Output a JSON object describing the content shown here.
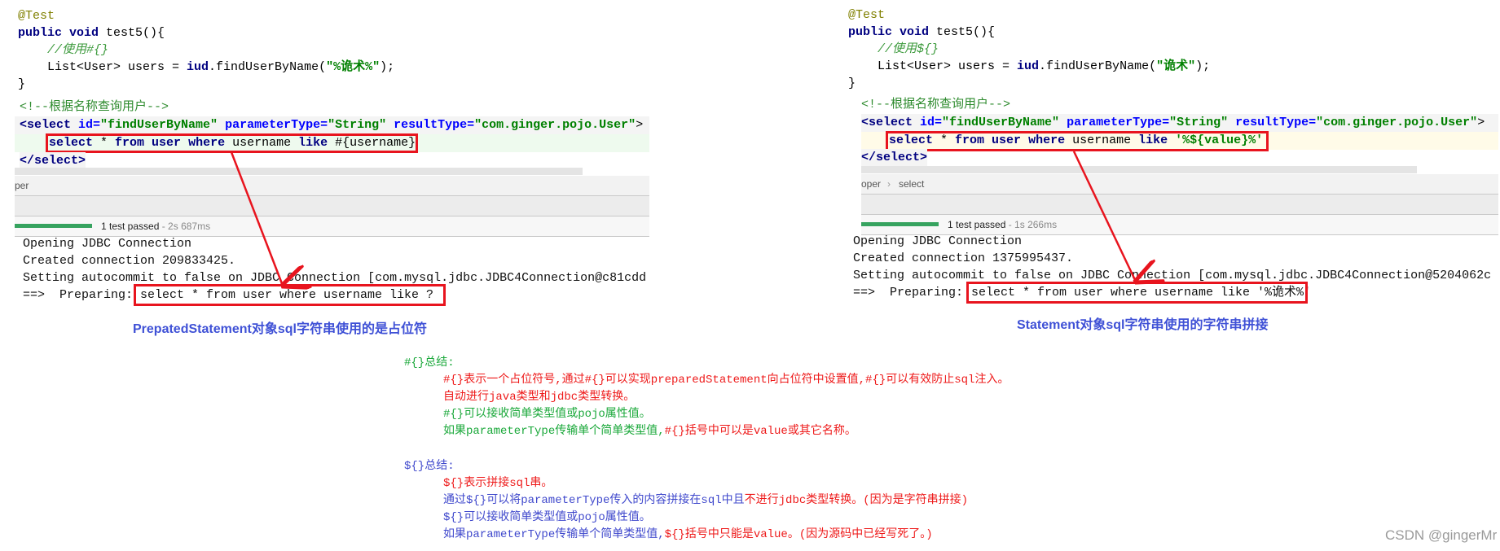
{
  "left": {
    "code": {
      "annotation": "@Test",
      "kw_public": "public",
      "kw_void": "void",
      "method": " test5(){",
      "comment": "//使用#{}",
      "list_decl": "List<User> users = ",
      "iud": "iud",
      "call": ".findUserByName(",
      "arg": "\"%诡术%\"",
      "call_end": ");",
      "close": "}",
      "xml_comment": "<!--根据名称查询用户-->",
      "tag_open": "<select",
      "attr_id": " id=",
      "val_id": "\"findUserByName\"",
      "attr_param": " parameterType=",
      "val_param": "\"String\"",
      "attr_result": " resultType=",
      "val_result": "\"com.ginger.pojo.User\"",
      "tag_gt": ">",
      "sql_select": "select",
      "sql_star": " * ",
      "sql_from": "from",
      "sql_user": " user ",
      "sql_where": "where",
      "sql_username": " username ",
      "sql_like": "like",
      "sql_param": " #{username}",
      "tag_close": "</select>"
    },
    "breadcrumb": "per",
    "test_status": "1 test passed",
    "test_time": " - 2s 687ms",
    "console": [
      "Opening JDBC Connection",
      "Created connection 209833425.",
      "Setting autocommit to false on JDBC Connection [com.mysql.jdbc.JDBC4Connection@c81cdd"
    ],
    "preparing_label": "==>  Preparing:",
    "preparing_sql": "select * from user where username like ?",
    "caption": "PrepatedStatement对象sql字符串使用的是占位符"
  },
  "right": {
    "code": {
      "annotation": "@Test",
      "kw_public": "public",
      "kw_void": "void",
      "method": " test5(){",
      "comment": "//使用${}",
      "list_decl": "List<User> users = ",
      "iud": "iud",
      "call": ".findUserByName(",
      "arg": "\"诡术\"",
      "call_end": ");",
      "close": "}",
      "xml_comment": "<!--根据名称查询用户-->",
      "tag_open": "<select",
      "attr_id": " id=",
      "val_id": "\"findUserByName\"",
      "attr_param": " parameterType=",
      "val_param": "\"String\"",
      "attr_result": " resultType=",
      "val_result": "\"com.ginger.pojo.User\"",
      "tag_gt": ">",
      "sql_select": "select",
      "sql_star": " * ",
      "sql_from": "from",
      "sql_user": " user ",
      "sql_where": "where",
      "sql_username": " username ",
      "sql_like": "like",
      "sql_param": " '%${value}%'",
      "tag_close": "</select>"
    },
    "breadcrumb_1": "oper",
    "breadcrumb_sep": "›",
    "breadcrumb_2": "select",
    "test_status": "1 test passed",
    "test_time": " - 1s 266ms",
    "console": [
      "Opening JDBC Connection",
      "Created connection 1375995437.",
      "Setting autocommit to false on JDBC Connection [com.mysql.jdbc.JDBC4Connection@5204062c"
    ],
    "preparing_label": "==>  Preparing:",
    "preparing_sql": "select * from user where username like '%诡术%'",
    "caption": "Statement对象sql字符串使用的字符串拼接"
  },
  "notes": {
    "hash_title": "#{}总结:",
    "hash_1a": "#{}表示一个占位符号,通过#{}可以实现preparedStatement向占位符中设置值,",
    "hash_1b": "#{}可以有效防止sql注入。",
    "hash_2": "自动进行java类型和jdbc类型转换。",
    "hash_3": "#{}可以接收简单类型值或pojo属性值。",
    "hash_4a": "如果parameterType传输单个简单类型值,",
    "hash_4b": "#{}括号中可以是value或其它名称。",
    "dollar_title": "${}总结:",
    "dollar_1": "${}表示拼接sql串。",
    "dollar_2a": "通过${}可以将parameterType传入的内容拼接在sql中且",
    "dollar_2b": "不进行jdbc类型转换。(因为是字符串拼接)",
    "dollar_3": "${}可以接收简单类型值或pojo属性值。",
    "dollar_4a": "如果parameterType传输单个简单类型值,",
    "dollar_4b": "${}括号中只能是value。(因为源码中已经写死了。)"
  },
  "watermark": "CSDN @gingerMr",
  "colors": {
    "highlight_box": "#e8141e",
    "arrow": "#e8141e",
    "caption": "#3f51d6",
    "progress": "#36a35f"
  }
}
